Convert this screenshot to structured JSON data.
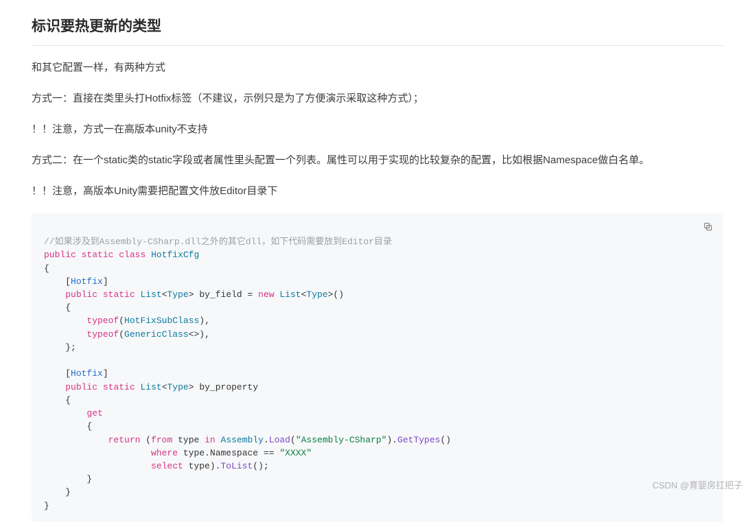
{
  "heading": "标识要热更新的类型",
  "paragraphs": [
    "和其它配置一样，有两种方式",
    "方式一：直接在类里头打Hotfix标签（不建议，示例只是为了方便演示采取这种方式）；",
    "！！注意，方式一在高版本unity不支持",
    "方式二：在一个static类的static字段或者属性里头配置一个列表。属性可以用于实现的比较复杂的配置，比如根据Namespace做白名单。",
    "！！注意，高版本Unity需要把配置文件放Editor目录下"
  ],
  "code": {
    "comment": "//如果涉及到Assembly-CSharp.dll之外的其它dll，如下代码需要放到Editor目录",
    "kw_public": "public",
    "kw_static": "static",
    "kw_class": "class",
    "class_name": "HotfixCfg",
    "attr_hotfix": "Hotfix",
    "type_list": "List",
    "type_type": "Type",
    "field_name": "by_field",
    "kw_new": "new",
    "kw_typeof": "typeof",
    "type_hotfixsub": "HotFixSubClass",
    "type_generic": "GenericClass",
    "prop_name": "by_property",
    "kw_get": "get",
    "kw_return": "return",
    "kw_from": "from",
    "id_type": "type",
    "kw_in": "in",
    "type_assembly": "Assembly",
    "m_load": "Load",
    "str_asm": "\"Assembly-CSharp\"",
    "m_gettypes": "GetTypes",
    "kw_where": "where",
    "m_ns": "Namespace",
    "eqeq": "==",
    "str_xxxx": "\"XXXX\"",
    "kw_select": "select",
    "m_tolist": "ToList"
  },
  "watermark": "CSDN @育婴房扛把子"
}
